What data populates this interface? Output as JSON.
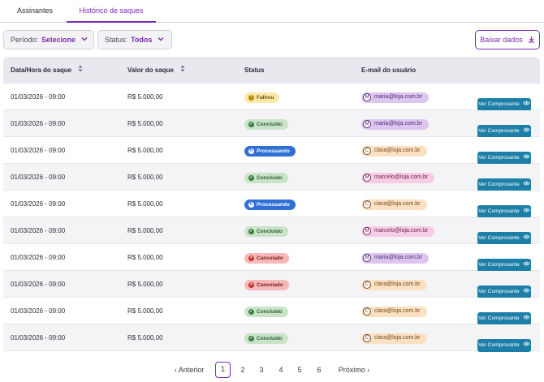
{
  "tabs": [
    {
      "label": "Assinantes",
      "active": false
    },
    {
      "label": "Histórico de saques",
      "active": true
    }
  ],
  "filters": {
    "period_label": "Período:",
    "period_value": "Selecione",
    "status_label": "Status:",
    "status_value": "Todos"
  },
  "download_label": "Baixar dados",
  "columns": {
    "date": "Data/Hora do saque",
    "amount": "Valor do saque",
    "status": "Status",
    "email": "E-mail do usuário"
  },
  "view_button_label": "Ver Comprovante",
  "status_styles": {
    "Falhou": {
      "bg": "#fbe8a8",
      "fg": "#6b5300",
      "icon": "!",
      "icon_bg": "#b88a00",
      "icon_name": "warning-icon"
    },
    "Concluído": {
      "bg": "#c9e3c9",
      "fg": "#2e5e32",
      "icon": "✓",
      "icon_bg": "#3b7a40",
      "icon_name": "check-circle-icon"
    },
    "Processando": {
      "bg": "#2f6fd6",
      "fg": "#ffffff",
      "icon": "↻",
      "icon_bg": "#ffffff",
      "icon_name": "hourglass-icon"
    },
    "Cancelado": {
      "bg": "#f6b8b8",
      "fg": "#7a1e1e",
      "icon": "×",
      "icon_bg": "#c23434",
      "icon_name": "x-circle-icon"
    }
  },
  "email_styles": {
    "maria": {
      "bg": "#dcc6ef",
      "fg": "#4d2a73"
    },
    "clara": {
      "bg": "#fbe0c2",
      "fg": "#6e4a1c"
    },
    "marcelo": {
      "bg": "#f7cde6",
      "fg": "#6e2150"
    }
  },
  "rows": [
    {
      "date": "01/03/2026 - 09:00",
      "amount": "R$ 5.000,00",
      "status": "Falhou",
      "email": "maria@loja.com.br",
      "initial": "M",
      "email_style": "maria"
    },
    {
      "date": "01/03/2026 - 09:00",
      "amount": "R$ 5.000,00",
      "status": "Concluído",
      "email": "maria@loja.com.br",
      "initial": "M",
      "email_style": "maria"
    },
    {
      "date": "01/03/2026 - 09:00",
      "amount": "R$ 5.000,00",
      "status": "Processando",
      "email": "clara@loja.com.br",
      "initial": "C",
      "email_style": "clara"
    },
    {
      "date": "01/03/2026 - 09:00",
      "amount": "R$ 5.000,00",
      "status": "Concluído",
      "email": "marcelo@loja.com.br",
      "initial": "M",
      "email_style": "marcelo"
    },
    {
      "date": "01/03/2026 - 09:00",
      "amount": "R$ 5.000,00",
      "status": "Processando",
      "email": "clara@loja.com.br",
      "initial": "C",
      "email_style": "clara"
    },
    {
      "date": "01/03/2026 - 09:00",
      "amount": "R$ 5.000,00",
      "status": "Concluído",
      "email": "marcelo@loja.com.br",
      "initial": "M",
      "email_style": "marcelo"
    },
    {
      "date": "01/03/2026 - 09:00",
      "amount": "R$ 5.000,00",
      "status": "Cancelado",
      "email": "maria@loja.com.br",
      "initial": "M",
      "email_style": "maria"
    },
    {
      "date": "01/03/2026 - 09:00",
      "amount": "R$ 5.000,00",
      "status": "Cancelado",
      "email": "clara@loja.com.br",
      "initial": "C",
      "email_style": "clara"
    },
    {
      "date": "01/03/2026 - 09:00",
      "amount": "R$ 5.000,00",
      "status": "Concluído",
      "email": "clara@loja.com.br",
      "initial": "C",
      "email_style": "clara"
    },
    {
      "date": "01/03/2026 - 09:00",
      "amount": "R$ 5.000,00",
      "status": "Concluído",
      "email": "clara@loja.com.br",
      "initial": "C",
      "email_style": "clara"
    }
  ],
  "pagination": {
    "prev_label": "Anterior",
    "next_label": "Próximo",
    "pages": [
      "1",
      "2",
      "3",
      "4",
      "5",
      "6"
    ],
    "current": "1"
  }
}
